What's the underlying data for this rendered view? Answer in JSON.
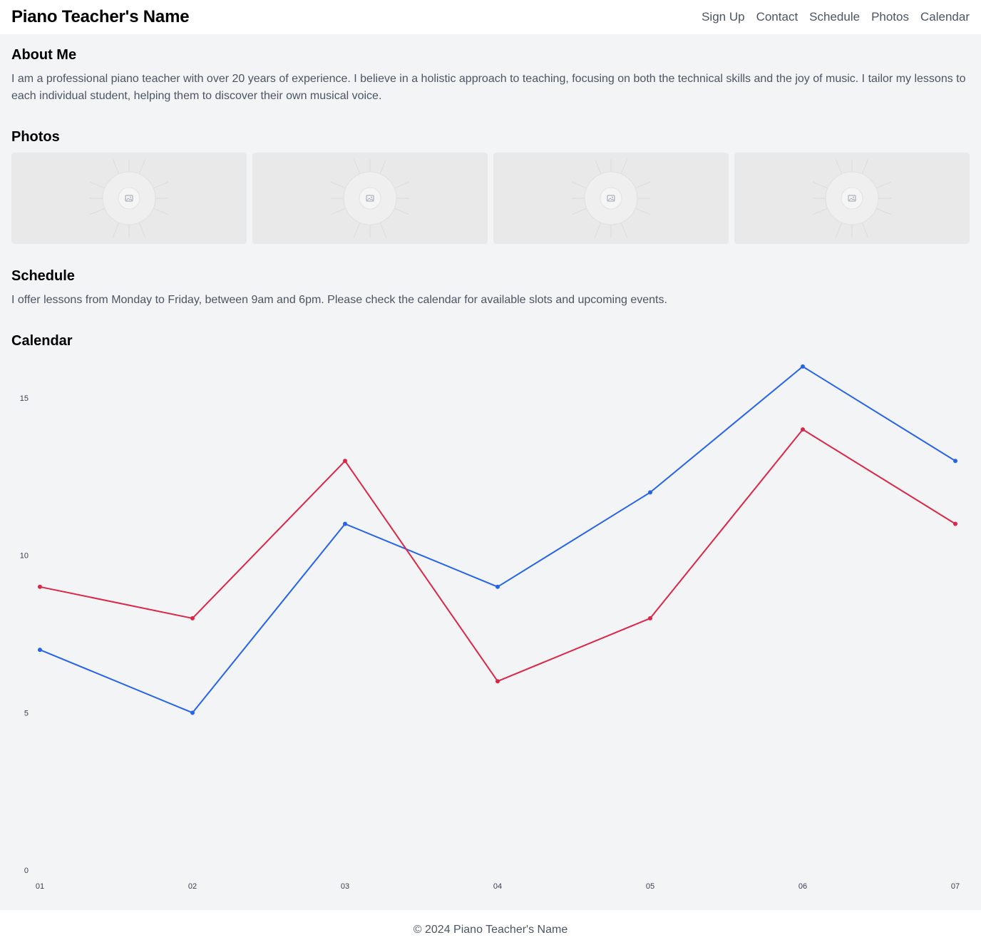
{
  "header": {
    "title": "Piano Teacher's Name",
    "nav": [
      "Sign Up",
      "Contact",
      "Schedule",
      "Photos",
      "Calendar"
    ]
  },
  "about": {
    "heading": "About Me",
    "text": "I am a professional piano teacher with over 20 years of experience. I believe in a holistic approach to teaching, focusing on both the technical skills and the joy of music. I tailor my lessons to each individual student, helping them to discover their own musical voice."
  },
  "photos": {
    "heading": "Photos",
    "count": 4,
    "icon": "image-placeholder-icon"
  },
  "schedule": {
    "heading": "Schedule",
    "text": "I offer lessons from Monday to Friday, between 9am and 6pm. Please check the calendar for available slots and upcoming events."
  },
  "calendar": {
    "heading": "Calendar"
  },
  "chart_data": {
    "type": "line",
    "title": "",
    "xlabel": "",
    "ylabel": "",
    "categories": [
      "01",
      "02",
      "03",
      "04",
      "05",
      "06",
      "07"
    ],
    "ylim": [
      0,
      15
    ],
    "yticks": [
      0,
      5,
      10,
      15
    ],
    "grid": false,
    "series": [
      {
        "color": "#2563eb",
        "values": [
          7,
          5,
          11,
          9,
          12,
          16,
          13
        ]
      },
      {
        "color": "#dc2647",
        "values": [
          9,
          8,
          13,
          6,
          8,
          14,
          11
        ]
      }
    ]
  },
  "footer": {
    "text": "© 2024 Piano Teacher's Name"
  }
}
